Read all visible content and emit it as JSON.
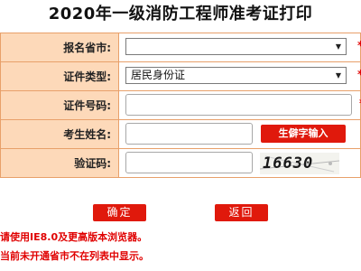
{
  "page": {
    "title": "2020年一级消防工程师准考证打印"
  },
  "form": {
    "province": {
      "label": "报名省市:",
      "value": ""
    },
    "id_type": {
      "label": "证件类型:",
      "value": "居民身份证"
    },
    "id_number": {
      "label": "证件号码:",
      "value": ""
    },
    "name": {
      "label": "考生姓名:",
      "value": "",
      "rare_char_button": "生僻字输入"
    },
    "captcha": {
      "label": "验证码:",
      "value": "",
      "image_text": "16630"
    },
    "required_mark": "*"
  },
  "buttons": {
    "confirm": "确定",
    "back": "返回"
  },
  "notices": {
    "browser": "请使用IE8.0及更高版本浏览器。",
    "province": "当前未开通省市不在列表中显示。"
  },
  "colors": {
    "label_bg": "#fdd9b9",
    "border": "#e8a06a",
    "accent_red": "#e0190c"
  }
}
